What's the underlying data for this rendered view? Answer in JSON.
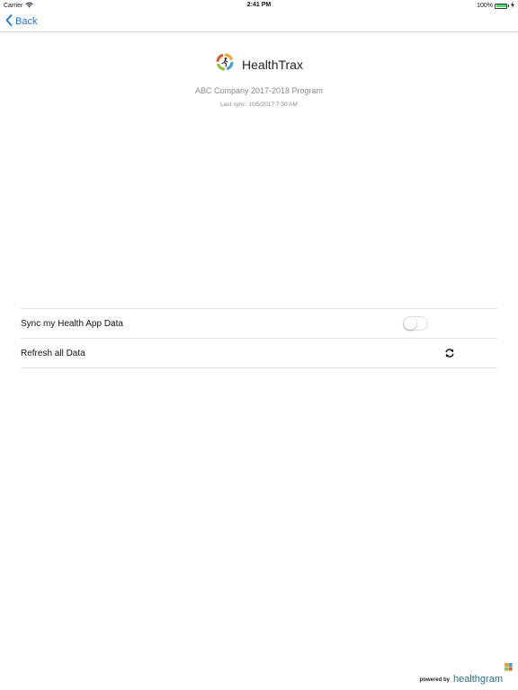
{
  "status_bar": {
    "carrier": "Carrier",
    "time": "2:41 PM",
    "battery": "100%",
    "battery_level": 1.0
  },
  "nav": {
    "back_label": "Back"
  },
  "header": {
    "app_name": "HealthTrax",
    "program": "ABC Company 2017-2018 Program",
    "last_sync": "Last sync: 10/5/2017 7:30 AM"
  },
  "settings": {
    "sync_label": "Sync my Health App Data",
    "sync_enabled": false,
    "refresh_label": "Refresh all Data"
  },
  "footer": {
    "powered_by": "powered by",
    "brand": "healthgram"
  },
  "colors": {
    "accent": "#1a73e8",
    "brand": "#2a6f86",
    "battery": "#4cd964"
  },
  "icons": {
    "wifi": "wifi-icon",
    "battery": "battery-icon",
    "charging": "charging-bolt-icon",
    "back": "chevron-left-icon",
    "logo": "healthtrax-logo-icon",
    "refresh": "refresh-icon",
    "brand_mark": "healthgram-logo-icon"
  }
}
